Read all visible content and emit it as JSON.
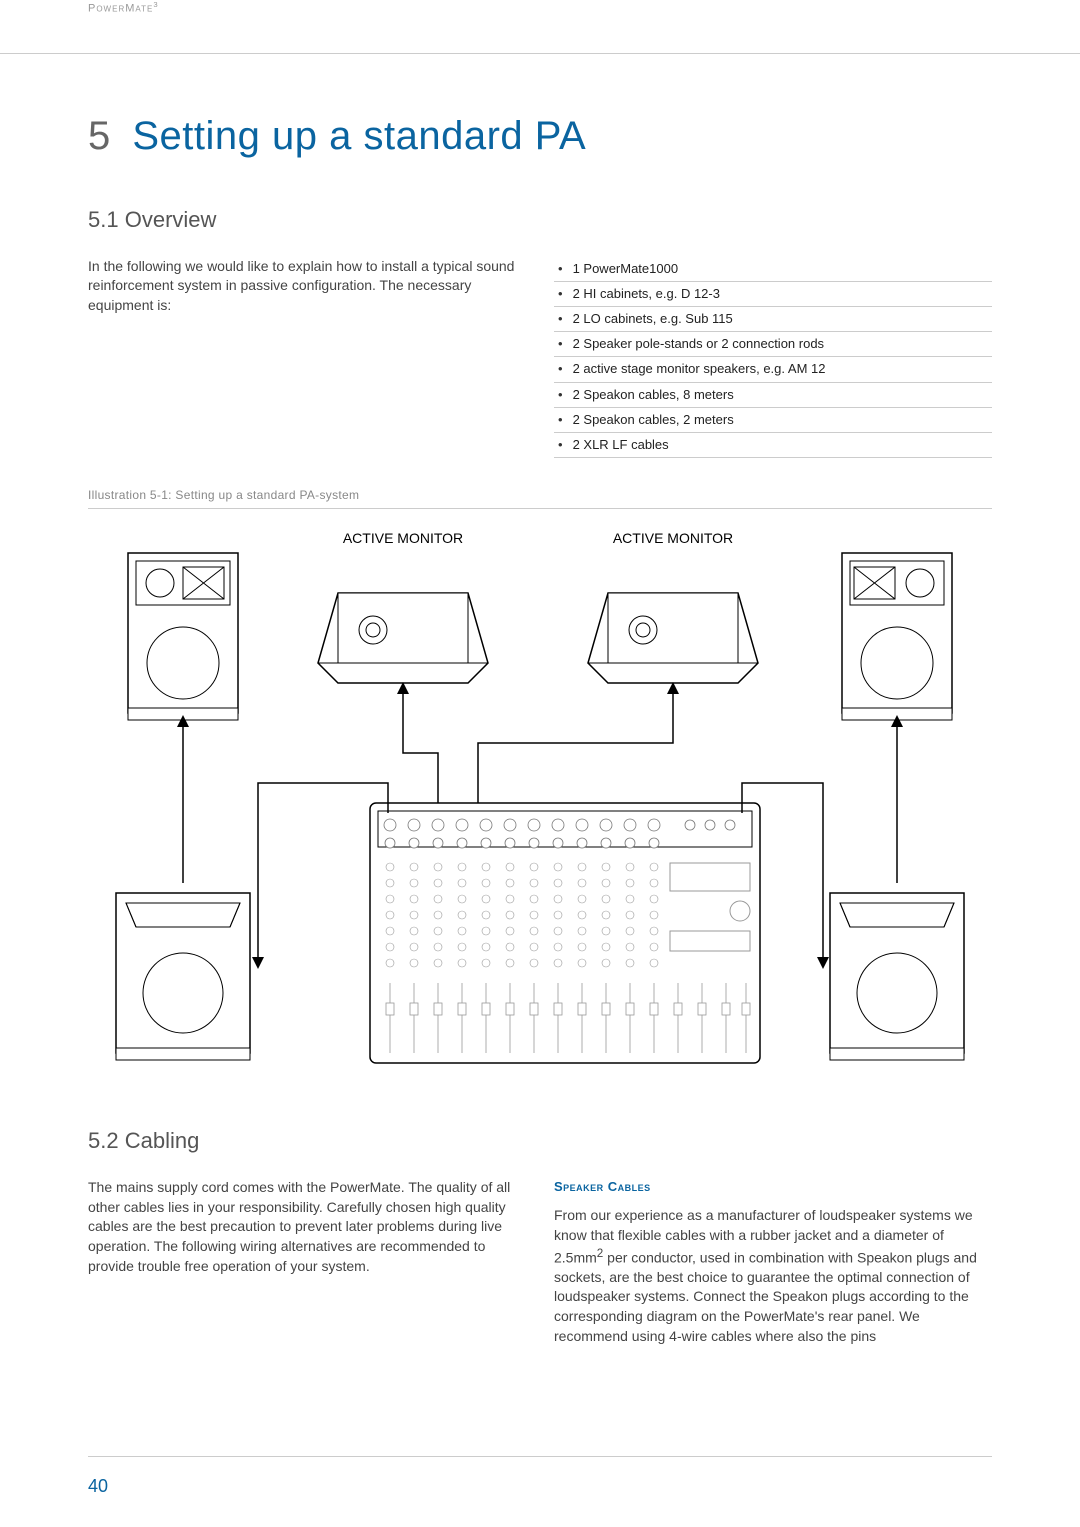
{
  "header": {
    "product_line": "PowerMate",
    "product_sup": "3"
  },
  "chapter": {
    "number": "5",
    "title": "Setting up a standard PA"
  },
  "section_overview": {
    "number": "5.1",
    "title": "Overview",
    "intro": "In the following we would like to explain how to install a typical sound reinforcement system in passive configuration. The necessary equipment is:",
    "equipment": [
      "1 PowerMate1000",
      "2 HI cabinets, e.g. D 12-3",
      "2 LO cabinets, e.g. Sub 115",
      "2 Speaker pole-stands or 2 connection rods",
      "2 active stage monitor speakers, e.g. AM 12",
      "2 Speakon cables, 8 meters",
      "2 Speakon cables, 2 meters",
      "2 XLR LF cables"
    ]
  },
  "illustration": {
    "caption": "Illustration 5-1: Setting up a standard PA-system",
    "labels": {
      "monitor_left": "ACTIVE MONITOR",
      "monitor_right": "ACTIVE MONITOR"
    }
  },
  "section_cabling": {
    "number": "5.2",
    "title": "Cabling",
    "intro": "The mains supply cord comes with the PowerMate. The quality of all other cables lies in your responsibility. Carefully chosen high quality cables are the best precaution to prevent later problems during live operation. The following wiring alternatives are recommended to provide trouble free operation of your system.",
    "speaker_cables_heading": "Speaker Cables",
    "speaker_cables_body_pre": "From our experience as a manufacturer of loudspeaker systems we know that flexible cables with a rubber jacket and a diameter of 2.5mm",
    "speaker_cables_body_post": " per conductor, used in combination with Speakon plugs and sockets, are the best choice to guarantee the optimal connection of loudspeaker systems. Connect the Speakon plugs according to the corresponding diagram on the PowerMate's rear panel. We recommend using 4-wire cables where also the pins"
  },
  "page_number": "40"
}
